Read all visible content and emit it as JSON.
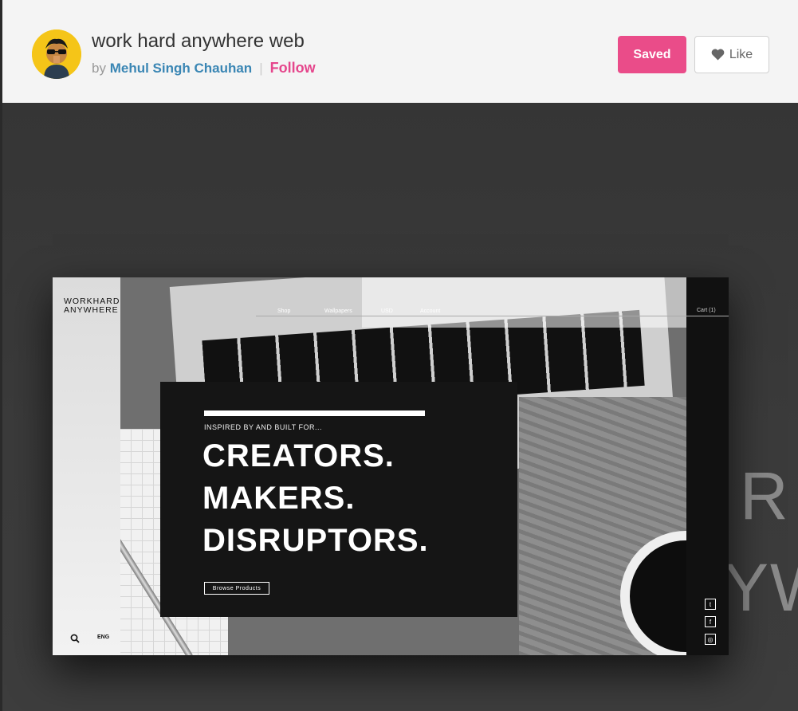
{
  "header": {
    "title": "work hard anywhere web",
    "by": "by",
    "author": "Mehul Singh Chauhan",
    "separator": "|",
    "follow": "Follow",
    "saved_label": "Saved",
    "like_label": "Like"
  },
  "shot": {
    "logo_line1": "WORKHARD",
    "logo_line2": "ANYWHERE",
    "nav": [
      "Shop",
      "Wallpapers",
      "USD",
      "Account"
    ],
    "cart": "Cart (1)",
    "kicker": "INSPIRED BY AND BUILT FOR...",
    "headline": [
      "CREATORS.",
      "MAKERS.",
      "DISRUPTORS."
    ],
    "browse": "Browse Products",
    "lang": "ENG",
    "social_icons": [
      "twitter-icon",
      "facebook-icon",
      "instagram-icon"
    ]
  },
  "background_text": {
    "line1": "R",
    "line2": "YW"
  },
  "colors": {
    "accent": "#ea4c89",
    "link": "#3a86b4"
  }
}
